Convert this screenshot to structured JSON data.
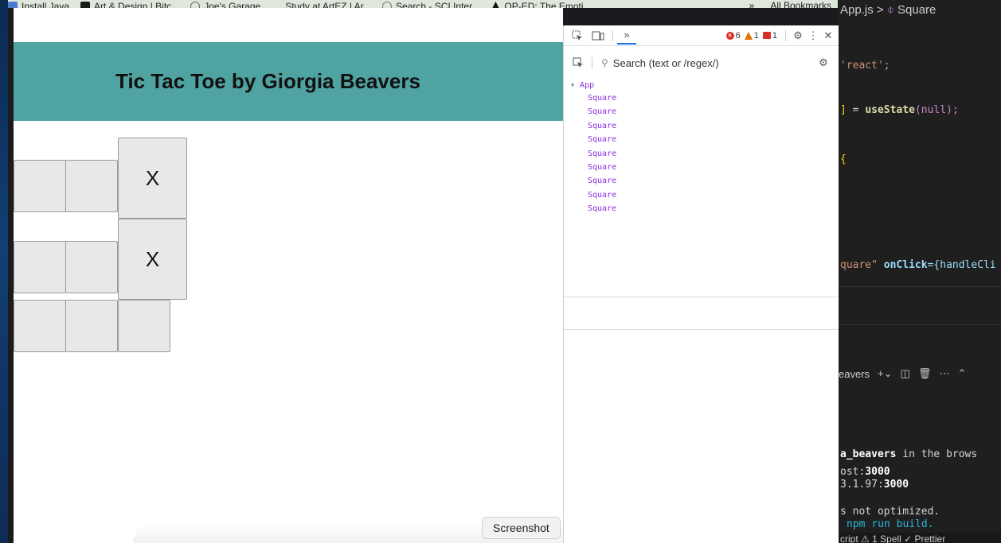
{
  "bookmarks": {
    "items": [
      {
        "label": "Install Java",
        "icon": "java-icon"
      },
      {
        "label": "Art & Design | Bitc...",
        "icon": "bitcoin-icon"
      },
      {
        "label": "Joe's Garage",
        "icon": "garage-icon"
      },
      {
        "label": "Study at ArtEZ | Ar...",
        "icon": "artez-icon"
      },
      {
        "label": "Search - SCI Inter...",
        "icon": "sci-icon"
      },
      {
        "label": "OP-ED: The Emoti...",
        "icon": "oped-icon"
      }
    ],
    "overflow": "»",
    "all_bookmarks": "All Bookmarks"
  },
  "page": {
    "title": "Tic Tac Toe by Giorgia Beavers",
    "header_color": "#4fa3a0",
    "squares": [
      "",
      "",
      "X",
      "",
      "",
      "X",
      "",
      "",
      ""
    ]
  },
  "tooltip": "Screenshot",
  "devtools": {
    "tab_more": "»",
    "errors": "6",
    "warnings": "1",
    "issues": "1",
    "search_placeholder": "Search (text or /regex/)",
    "tree_root": "App",
    "tree_children": [
      "Square",
      "Square",
      "Square",
      "Square",
      "Square",
      "Square",
      "Square",
      "Square",
      "Square"
    ]
  },
  "editor": {
    "breadcrumb_file": "App.js",
    "breadcrumb_sep": ">",
    "breadcrumb_symbol": "Square",
    "code": {
      "line_import": "'react';",
      "line_state_eq": "=",
      "line_state_fn": "useState",
      "line_state_arg": "(null);",
      "line_brace": "{",
      "line_jsx_str": "quare\"",
      "line_jsx_attr": "onClick",
      "line_jsx_rest": "={handleCli"
    },
    "terminal": {
      "tab_label": "eavers",
      "line1_bold": "a_beavers",
      "line1_rest": " in the brows",
      "line2_pre": "ost:",
      "line2_port": "3000",
      "line3_pre": "3.1.97:",
      "line3_port": "3000",
      "line4": "s not optimized.",
      "line5": "npm run build."
    },
    "status": "cript   ⚠ 1 Spell   ✓ Prettier"
  }
}
